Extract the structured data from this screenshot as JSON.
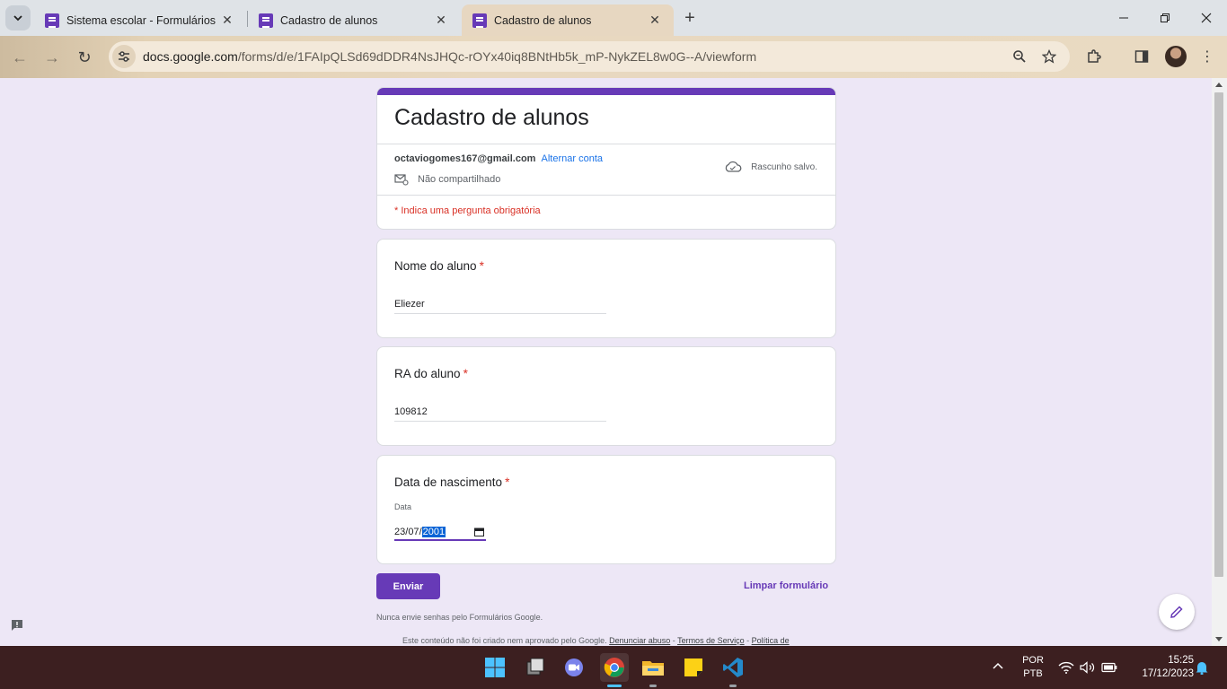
{
  "browser": {
    "tabs": [
      {
        "title": "Sistema escolar - Formulários G",
        "active": false
      },
      {
        "title": "Cadastro de alunos",
        "active": false
      },
      {
        "title": "Cadastro de alunos",
        "active": true
      }
    ],
    "url_host": "docs.google.com",
    "url_path": "/forms/d/e/1FAIpQLSd69dDDR4NsJHQc-rOYx40iq8BNtHb5k_mP-NykZEL8w0G--A/viewform"
  },
  "form": {
    "title": "Cadastro de alunos",
    "account_email": "octaviogomes167@gmail.com",
    "switch_account": "Alternar conta",
    "share_status": "Não compartilhado",
    "draft_status": "Rascunho salvo.",
    "required_note": "* Indica uma pergunta obrigatória",
    "accent_color": "#673ab7",
    "questions": [
      {
        "title": "Nome do aluno",
        "required_mark": "*",
        "answer": "Eliezer"
      },
      {
        "title": "RA do aluno",
        "required_mark": "*",
        "answer": "109812"
      },
      {
        "title": "Data de nascimento",
        "required_mark": "*",
        "date_label": "Data",
        "date_day": "23",
        "date_sep1": "/",
        "date_month": "07",
        "date_sep2": "/",
        "date_year": "2001"
      }
    ],
    "submit_label": "Enviar",
    "clear_label": "Limpar formulário",
    "footer_warning": "Nunca envie senhas pelo Formulários Google.",
    "footer_disclaimer": "Este conteúdo não foi criado nem aprovado pelo Google.",
    "footer_links": [
      "Denunciar abuso",
      "Termos de Serviço",
      "Política de"
    ],
    "footer_sep": " - "
  },
  "taskbar": {
    "lang_top": "POR",
    "lang_bottom": "PTB",
    "time": "15:25",
    "date": "17/12/2023"
  }
}
